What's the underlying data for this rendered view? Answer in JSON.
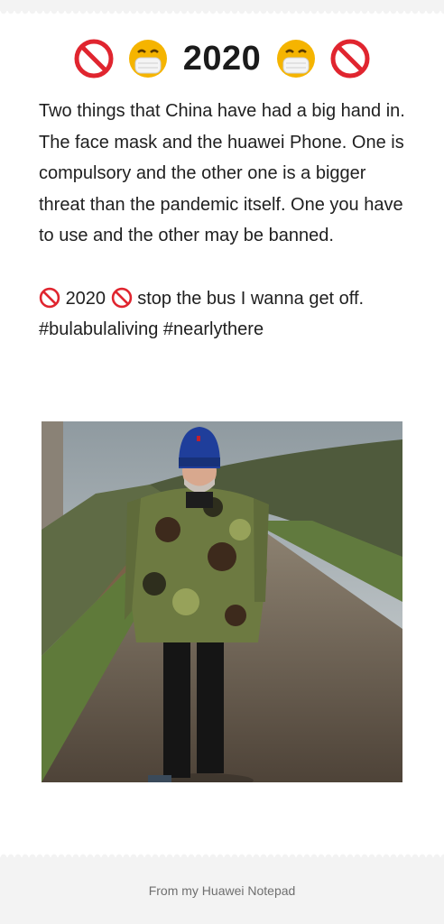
{
  "note": {
    "title": "2020",
    "title_icons": [
      "no-entry-icon",
      "face-mask-icon",
      "face-mask-icon",
      "no-entry-icon"
    ],
    "paragraph1": "Two things that China have had a big hand in. The face mask and the huawei Phone. One is compulsory and the other one is a bigger threat than the pandemic itself. One you have to use and the other may be banned.",
    "paragraph2_year": "2020",
    "paragraph2_tail": "stop the bus I wanna get off.",
    "hashtags": "#bulabulaliving #nearlythere"
  },
  "colors": {
    "no_entry_red": "#e0252f",
    "mask_face_yellow": "#f5b400",
    "page_bg": "#f3f3f3"
  },
  "footer": {
    "label": "From my Huawei Notepad"
  }
}
